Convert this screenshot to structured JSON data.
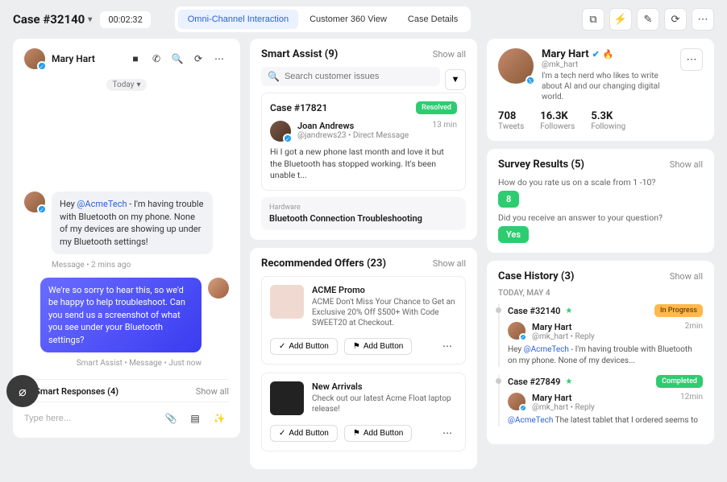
{
  "header": {
    "case_title": "Case #32140",
    "timer": "00:02:32",
    "tabs": [
      "Omni-Channel Interaction",
      "Customer 360 View",
      "Case Details"
    ],
    "active_tab": 0
  },
  "conversation": {
    "name": "Mary Hart",
    "day_label": "Today",
    "incoming": {
      "mention": "@AcmeTech",
      "text_prefix": "Hey ",
      "text_suffix": " - I'm having trouble with Bluetooth on my phone. None of my devices are showing up under my Bluetooth settings!",
      "meta": "Message • 2 mins ago"
    },
    "outgoing": {
      "text": "We're so sorry to hear this, so we'd be happy to help troubleshoot. Can you send us a screenshot of what you see under your Bluetooth settings?",
      "meta": "Smart Assist • Message • Just now"
    },
    "smart_responses_title": "Smart Responses (4)",
    "show_all": "Show all",
    "composer_placeholder": "Type here..."
  },
  "smart_assist": {
    "title": "Smart Assist (9)",
    "show_all": "Show all",
    "search_placeholder": "Search customer issues",
    "case": {
      "id": "Case #17821",
      "status": "Resolved",
      "person_name": "Joan Andrews",
      "person_handle": "@jandrews23 • Direct Message",
      "time": "13 min",
      "body": "Hi I got a new phone last month and love it but the Bluetooth has stopped working. It's been unable t..."
    },
    "hardware": {
      "label": "Hardware",
      "title": "Bluetooth Connection Troubleshooting"
    }
  },
  "offers": {
    "title": "Recommended Offers (23)",
    "show_all": "Show all",
    "items": [
      {
        "title": "ACME Promo",
        "desc": "ACME Don't Miss Your Chance to Get an Exclusive 20% Off $500+ With Code SWEET20 at Checkout."
      },
      {
        "title": "New Arrivals",
        "desc": "Check out our latest Acme Float laptop release!"
      }
    ],
    "add_btn_check": "Add Button",
    "add_btn_flag": "Add Button"
  },
  "profile": {
    "name": "Mary Hart",
    "handle": "@mk_hart",
    "bio": "I'm a tech nerd who likes to write about AI and our changing digital world.",
    "stats": [
      {
        "n": "708",
        "l": "Tweets"
      },
      {
        "n": "16.3K",
        "l": "Followers"
      },
      {
        "n": "5.3K",
        "l": "Following"
      }
    ]
  },
  "survey": {
    "title": "Survey Results (5)",
    "show_all": "Show all",
    "q1": "How do you rate us on a scale from 1 -10?",
    "a1": "8",
    "q2": "Did you receive an answer to your question?",
    "a2": "Yes"
  },
  "history": {
    "title": "Case History (3)",
    "show_all": "Show all",
    "day": "TODAY, MAY 4",
    "items": [
      {
        "id": "Case #32140",
        "status": "In Progress",
        "status_class": "orange",
        "person": "Mary Hart",
        "handle": "@mk_hart • Reply",
        "time": "2min",
        "body_prefix": "Hey ",
        "mention": "@AcmeTech",
        "body_suffix": " - I'm having trouble with Bluetooth on my phone. None of my devices..."
      },
      {
        "id": "Case #27849",
        "status": "Completed",
        "status_class": "green2",
        "person": "Mary Hart",
        "handle": "@mk_hart • Reply",
        "time": "12min",
        "body_prefix": "",
        "mention": "@AcmeTech",
        "body_suffix": " The latest tablet that I ordered seems to"
      }
    ]
  }
}
